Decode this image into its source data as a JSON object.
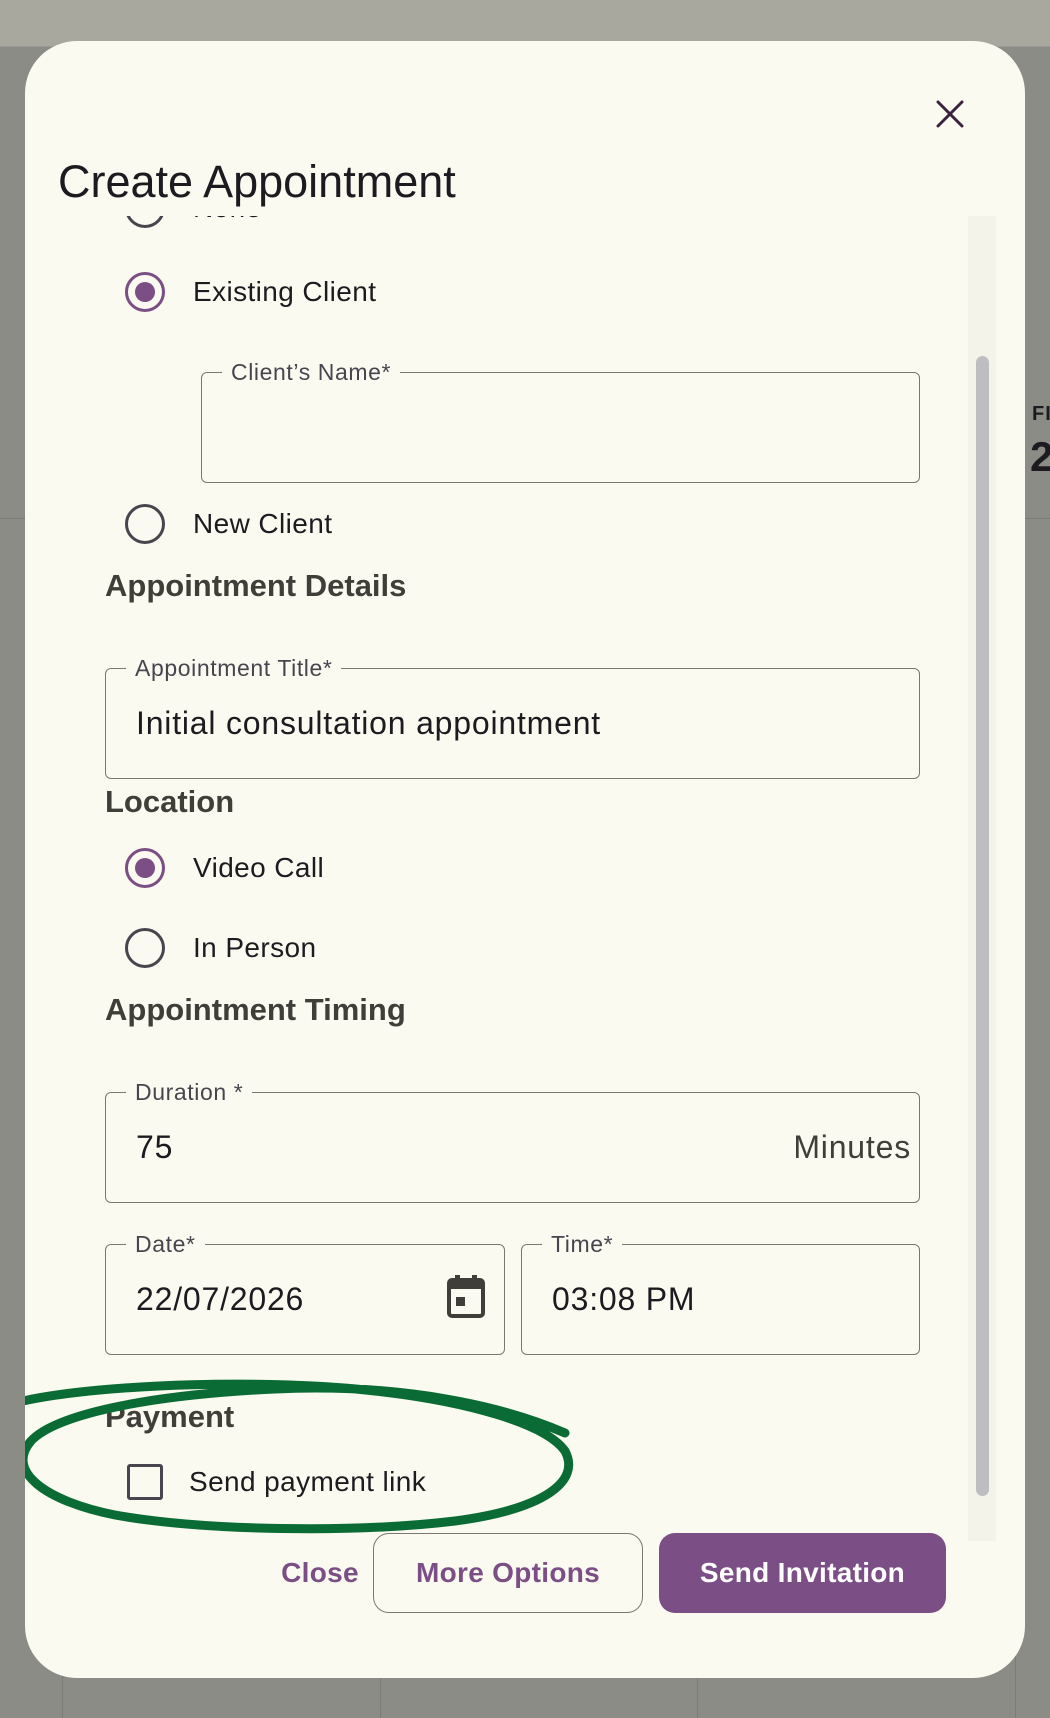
{
  "background": {
    "side_label": "FI",
    "side_number": "2"
  },
  "modal": {
    "title": "Create Appointment",
    "client": {
      "options": [
        {
          "label": "None",
          "selected": false
        },
        {
          "label": "Existing Client",
          "selected": true
        },
        {
          "label": "New Client",
          "selected": false
        }
      ],
      "client_name": {
        "label": "Client’s Name*",
        "value": ""
      }
    },
    "details": {
      "heading": "Appointment Details",
      "title_field": {
        "label": "Appointment Title*",
        "value": "Initial consultation appointment"
      }
    },
    "location": {
      "heading": "Location",
      "options": [
        {
          "label": "Video Call",
          "selected": true
        },
        {
          "label": "In Person",
          "selected": false
        }
      ]
    },
    "timing": {
      "heading": "Appointment Timing",
      "duration": {
        "label": "Duration *",
        "value": "75",
        "suffix": "Minutes"
      },
      "date": {
        "label": "Date*",
        "value": "22/07/2026",
        "icon": "calendar-icon"
      },
      "time": {
        "label": "Time*",
        "value": "03:08 PM"
      }
    },
    "payment": {
      "heading": "Payment",
      "send_link": {
        "label": "Send payment link",
        "checked": false
      }
    },
    "actions": {
      "close": "Close",
      "more_options": "More Options",
      "send_invitation": "Send Invitation"
    }
  },
  "colors": {
    "accent": "#7b4f85",
    "surface": "#fafaf0",
    "annotation": "#0b6b35",
    "overlay": "#8c8c87"
  }
}
